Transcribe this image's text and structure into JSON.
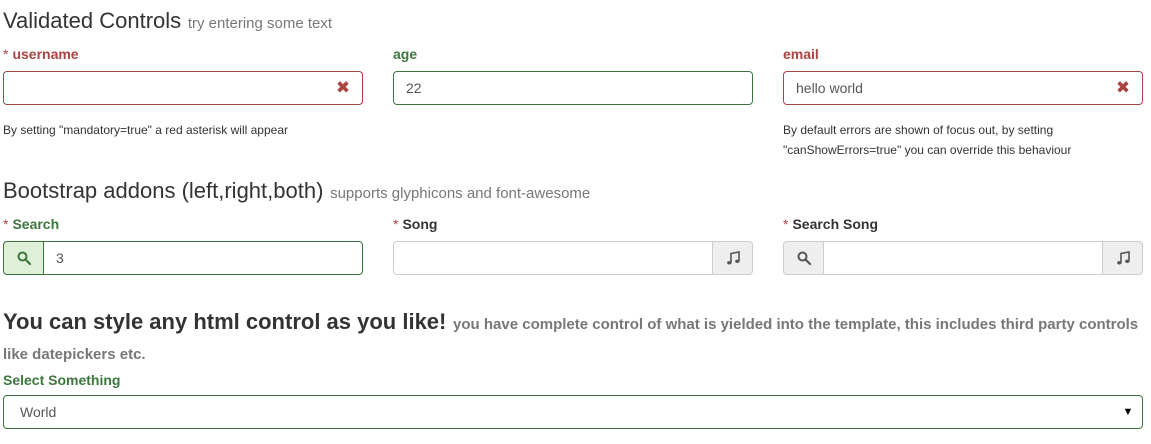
{
  "section1": {
    "title": "Validated Controls",
    "subtitle": "try entering some text"
  },
  "username": {
    "required_marker": "*",
    "label": "username",
    "value": "",
    "feedback_icon": "remove-icon",
    "help": "By setting \"mandatory=true\" a red asterisk will appear"
  },
  "age": {
    "label": "age",
    "value": "22"
  },
  "email": {
    "label": "email",
    "value": "hello world",
    "feedback_icon": "remove-icon",
    "help_line1": "By default errors are shown of focus out, by setting",
    "help_line2": "\"canShowErrors=true\" you can override this behaviour"
  },
  "section2": {
    "title": "Bootstrap addons (left,right,both)",
    "subtitle": "supports glyphicons and font-awesome"
  },
  "search": {
    "required_marker": "*",
    "label": "Search",
    "value": "3",
    "left_icon": "search-icon"
  },
  "song": {
    "required_marker": "*",
    "label": "Song",
    "value": "",
    "right_icon": "music-icon"
  },
  "search_song": {
    "required_marker": "*",
    "label": "Search Song",
    "value": "",
    "left_icon": "search-icon",
    "right_icon": "music-icon"
  },
  "section3": {
    "title": "You can style any html control as you like!",
    "subtitle": "you have complete control of what is yielded into the template, this includes third party controls like datepickers etc."
  },
  "select_something": {
    "label": "Select Something",
    "selected": "World"
  },
  "colors": {
    "error": "#a94442",
    "success": "#3c763d",
    "success_bg": "#dff0d8"
  }
}
